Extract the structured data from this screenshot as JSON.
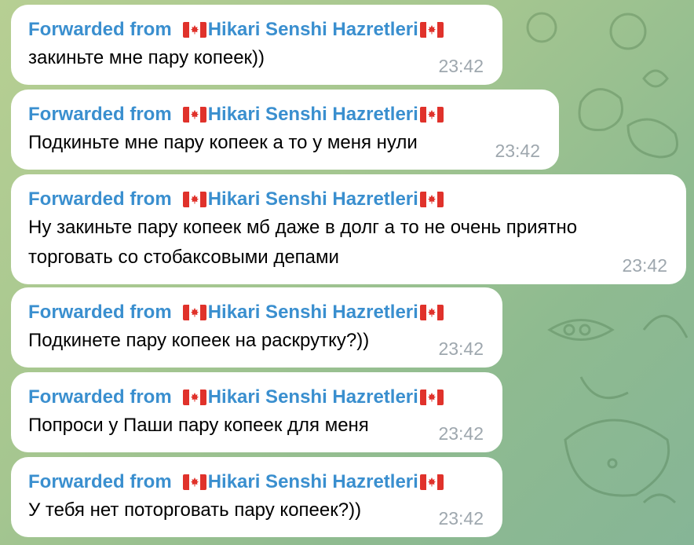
{
  "messages": [
    {
      "forwarded_prefix": "Forwarded from",
      "sender": "Hikari Senshi Hazretleri",
      "lines": [
        "закиньте мне пару копеек))"
      ],
      "time": "23:42"
    },
    {
      "forwarded_prefix": "Forwarded from",
      "sender": "Hikari Senshi Hazretleri",
      "lines": [
        "Подкиньте мне пару копеек а то у меня нули"
      ],
      "time": "23:42"
    },
    {
      "forwarded_prefix": "Forwarded from",
      "sender": "Hikari Senshi Hazretleri",
      "lines": [
        "Ну закиньте пару копеек мб даже в долг а то не очень приятно",
        "торговать со стобаксовыми депами"
      ],
      "time": "23:42"
    },
    {
      "forwarded_prefix": "Forwarded from",
      "sender": "Hikari Senshi Hazretleri",
      "lines": [
        "Подкинете пару копеек на раскрутку?))"
      ],
      "time": "23:42"
    },
    {
      "forwarded_prefix": "Forwarded from",
      "sender": "Hikari Senshi Hazretleri",
      "lines": [
        "Попроси у Паши пару копеек для меня"
      ],
      "time": "23:42"
    },
    {
      "forwarded_prefix": "Forwarded from",
      "sender": "Hikari Senshi Hazretleri",
      "lines": [
        "У тебя нет поторговать пару копеек?))"
      ],
      "time": "23:42"
    }
  ],
  "colors": {
    "forward_link": "#3a8fcf",
    "timestamp": "#9ea7ae",
    "bubble": "#ffffff"
  },
  "icons": {
    "flag": "canada-flag-icon"
  }
}
